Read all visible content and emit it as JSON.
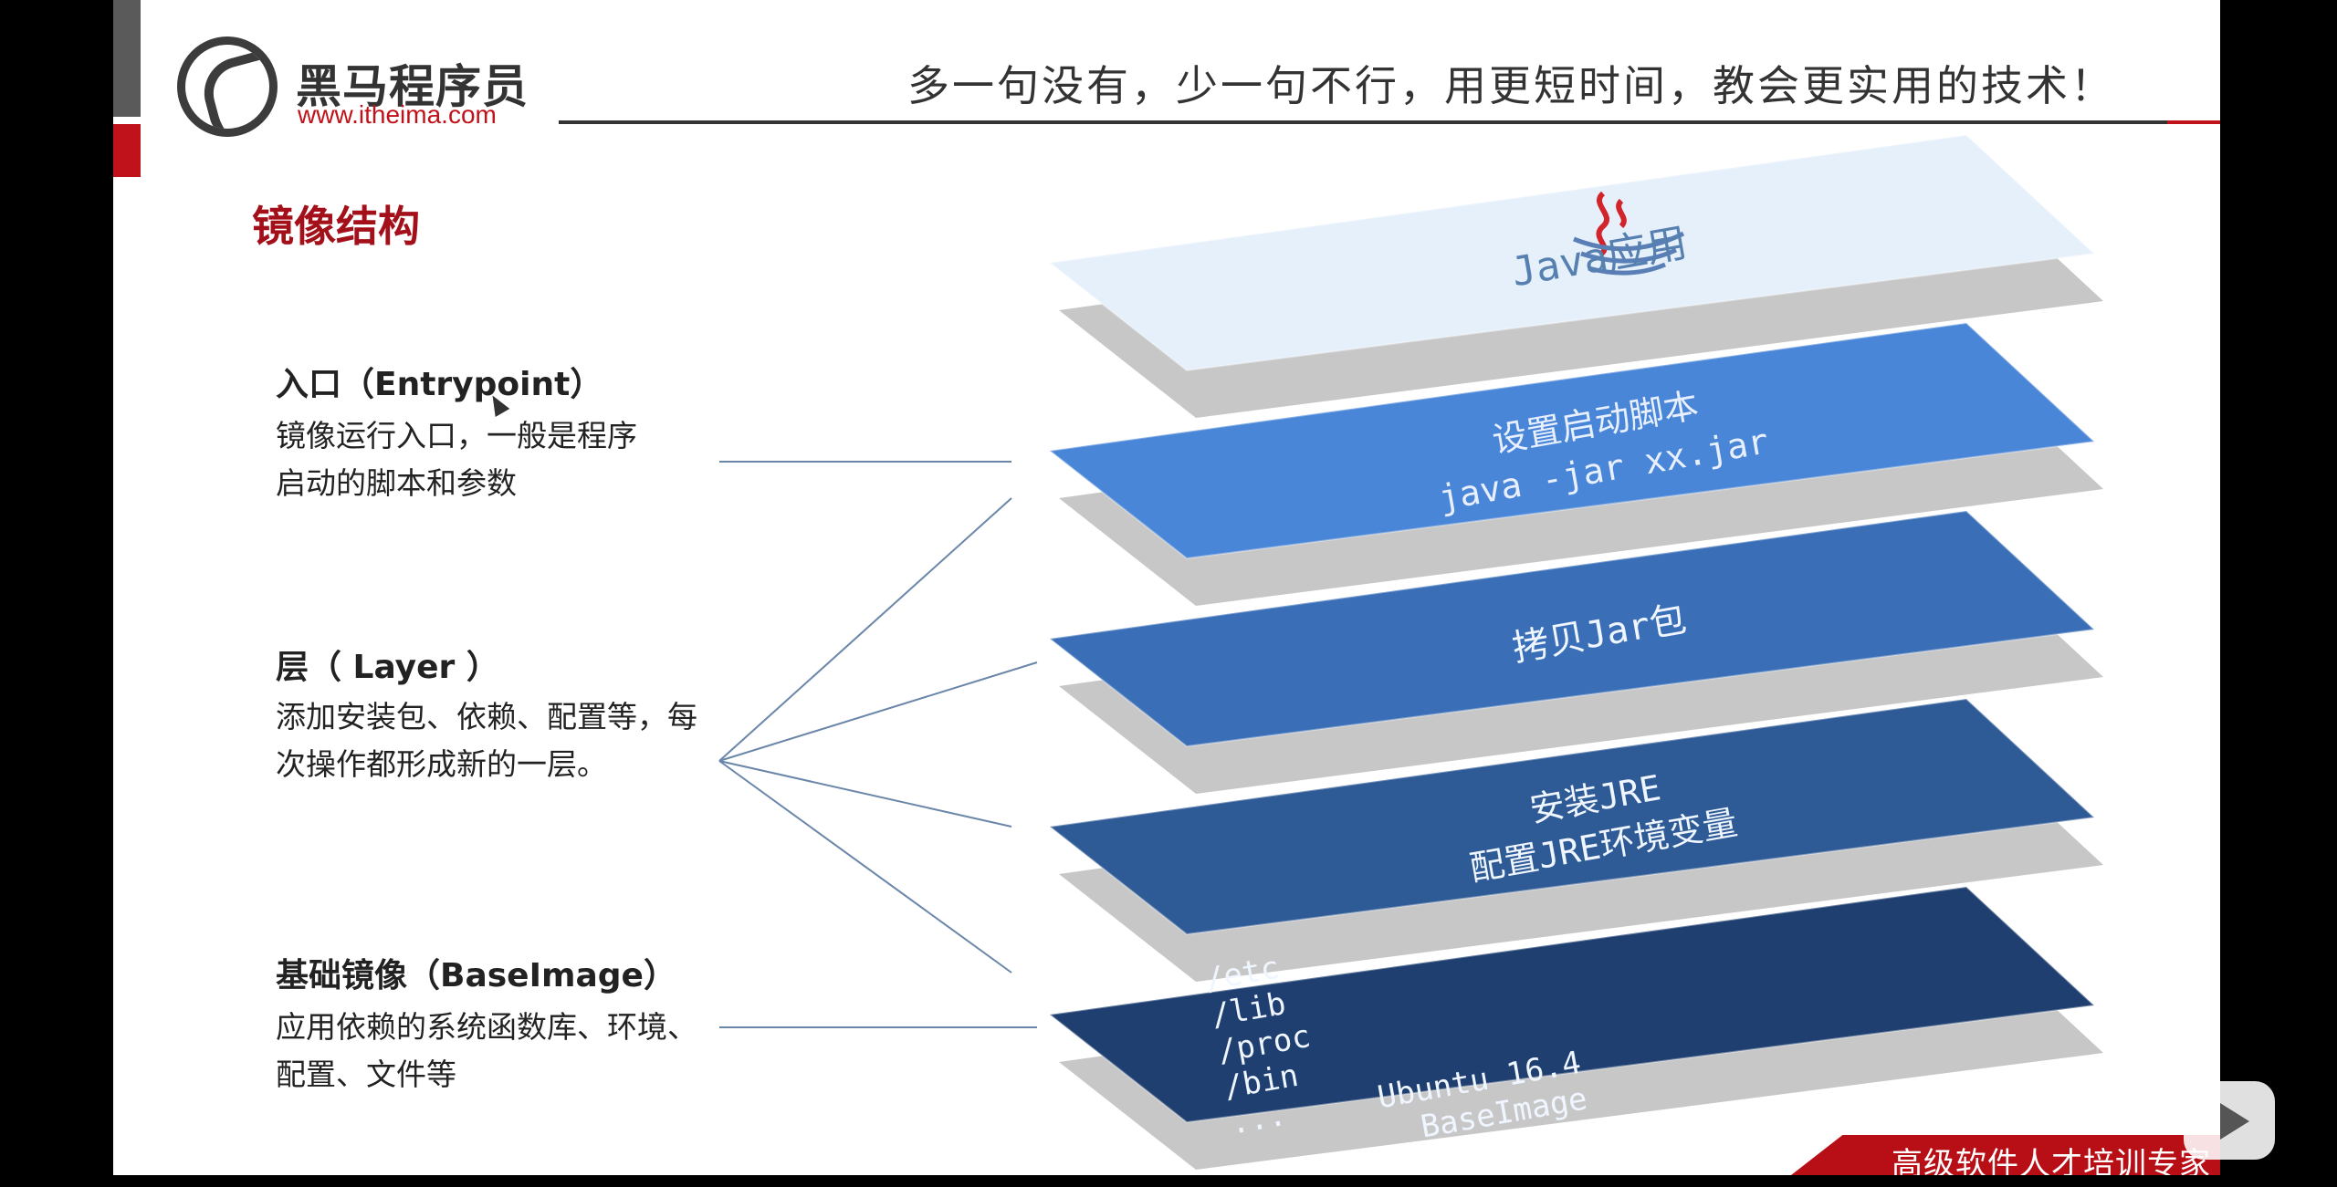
{
  "header": {
    "logo_title": "黑马程序员",
    "logo_url": "www.itheima.com",
    "slogan": "多一句没有，少一句不行，用更短时间，教会更实用的技术！"
  },
  "section_title": "镜像结构",
  "labels": [
    {
      "title": "入口（Entrypoint）",
      "desc_lines": [
        "镜像运行入口，一般是程序",
        "启动的脚本和参数"
      ]
    },
    {
      "title": "层（ Layer ）",
      "desc_lines": [
        "添加安装包、依赖、配置等，每",
        "次操作都形成新的一层。"
      ]
    },
    {
      "title": "基础镜像（BaseImage）",
      "desc_lines": [
        "应用依赖的系统函数库、环境、",
        "配置、文件等"
      ]
    }
  ],
  "layers": [
    {
      "text": "Java应用",
      "color": "#e6f0fb",
      "text_color": "#5580b0"
    },
    {
      "text": "设置启动脚本\njava -jar xx.jar",
      "color": "#4a86d8",
      "text_color": "#e8f0ff"
    },
    {
      "text": "拷贝Jar包",
      "color": "#3a6fb8",
      "text_color": "#f0f6ff"
    },
    {
      "text": "安装JRE\n配置JRE环境变量",
      "color": "#2e5a96",
      "text_color": "#f0f6ff"
    },
    {
      "text": "/etc\n/lib\n/proc\n/bin\n...     Ubuntu 16.4\n          BaseImage",
      "color": "#1e3f70",
      "text_color": "#f0f6ff"
    }
  ],
  "footer": {
    "badge": "高级软件人才培训专家"
  },
  "icons": {
    "java_logo": "java-cup-icon",
    "play_button": "play-icon",
    "cursor": "cursor-icon"
  },
  "colors": {
    "brand_red": "#c0121a",
    "title_red": "#a3101a"
  }
}
